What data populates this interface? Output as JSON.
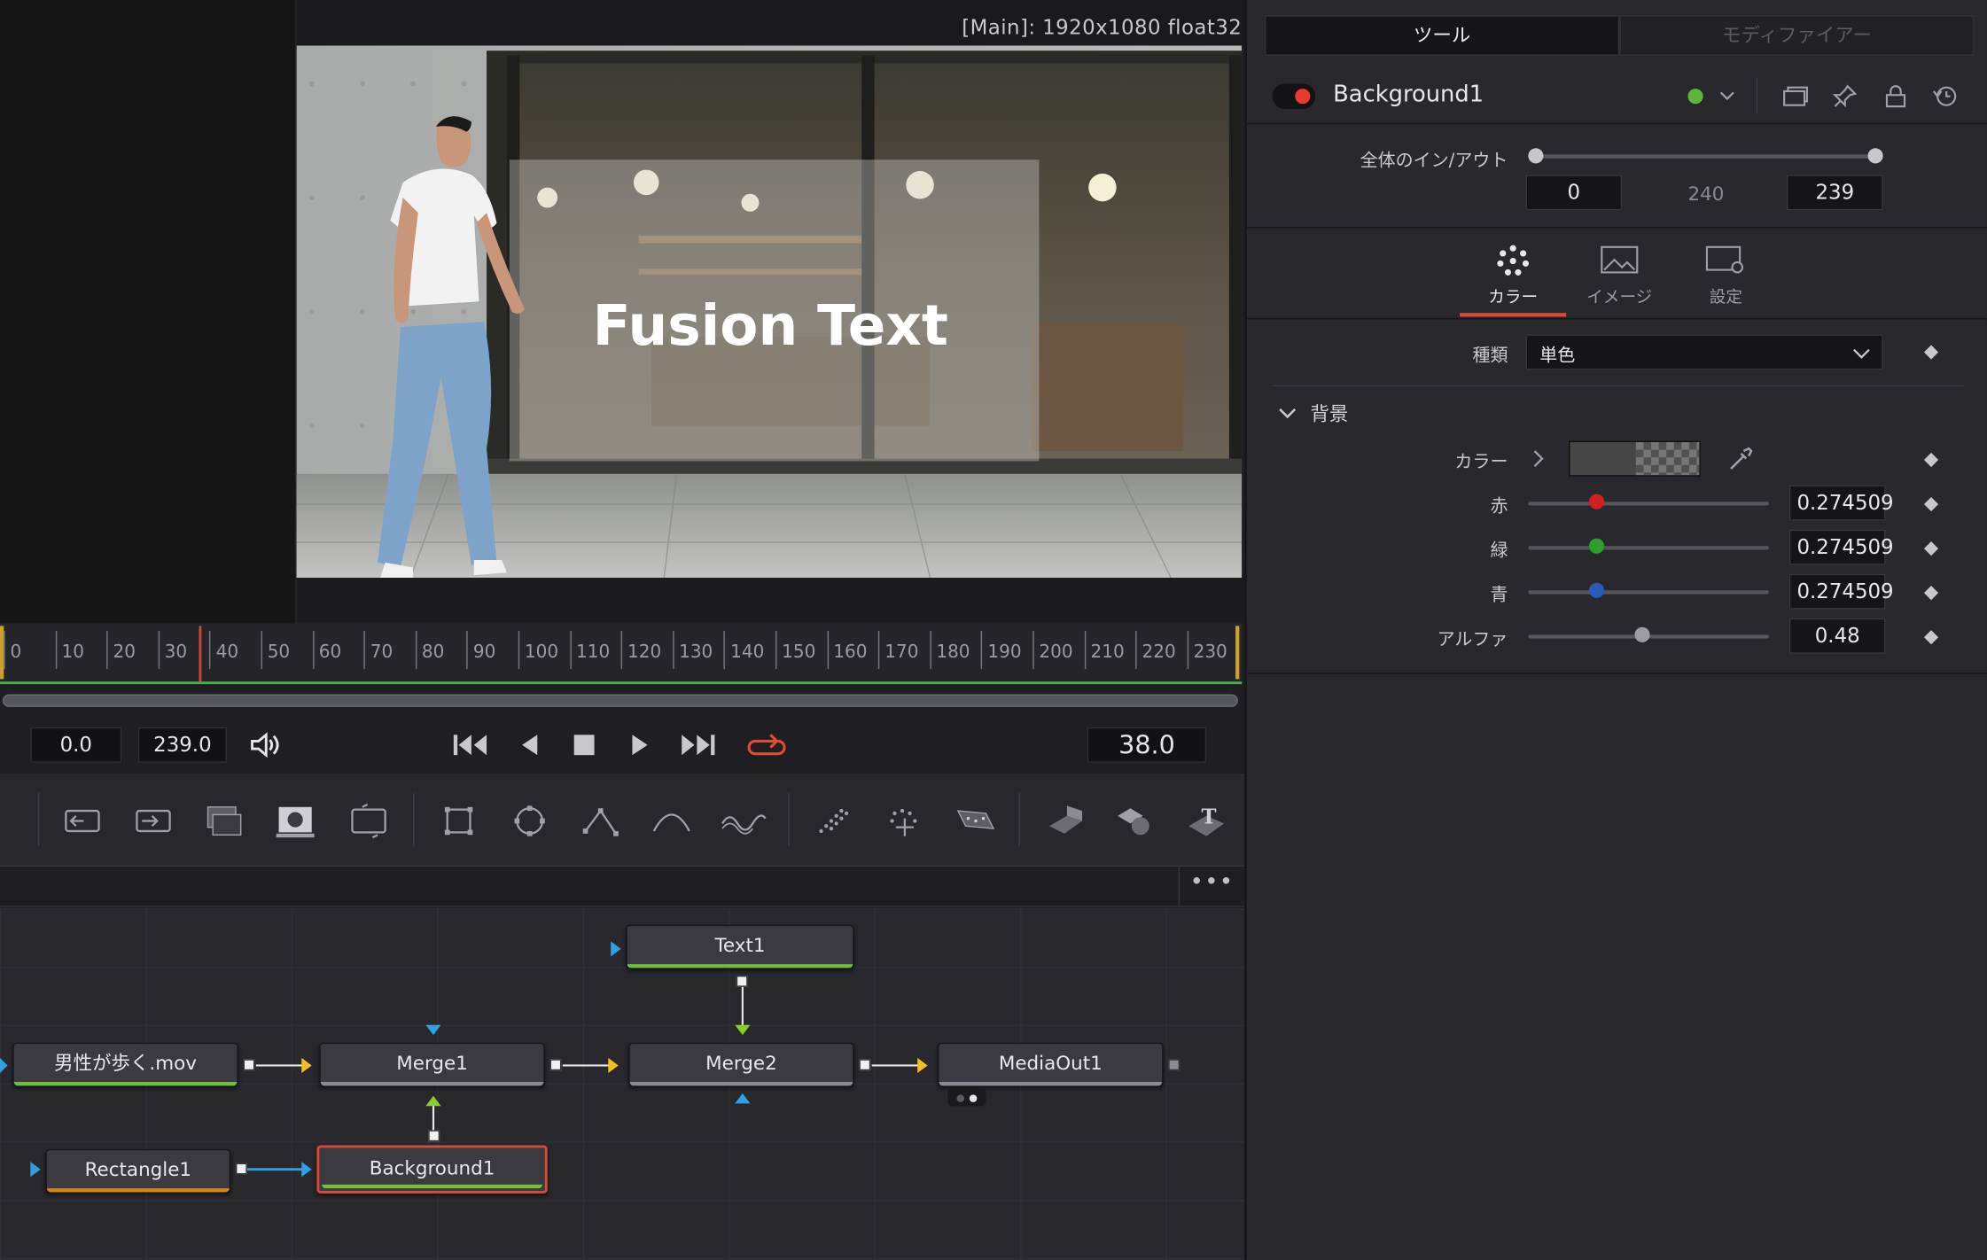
{
  "viewer": {
    "info": "[Main]: 1920x1080 float32",
    "overlay_text": "Fusion Text"
  },
  "timeline": {
    "ticks": [
      "0",
      "10",
      "20",
      "30",
      "40",
      "50",
      "60",
      "70",
      "80",
      "90",
      "100",
      "110",
      "120",
      "130",
      "140",
      "150",
      "160",
      "170",
      "180",
      "190",
      "200",
      "210",
      "220",
      "230"
    ],
    "playhead_frame": 38
  },
  "transport": {
    "start": "0.0",
    "end": "239.0",
    "current": "38.0"
  },
  "toolbar": {
    "icons": [
      "merge-icon",
      "channel-booleans-icon",
      "matte-control-icon",
      "mask-paint-icon",
      "transform-icon",
      "rectangle-mask-icon",
      "ellipse-mask-icon",
      "polygon-mask-icon",
      "bspline-mask-icon",
      "paint-icon",
      "particle-emitter-icon",
      "particle-render-icon",
      "particle-plane-icon",
      "shape3d-icon",
      "merge3d-icon",
      "text3d-icon"
    ]
  },
  "nodes": {
    "text1": "Text1",
    "clip": "男性が歩く.mov",
    "merge1": "Merge1",
    "merge2": "Merge2",
    "mediaout": "MediaOut1",
    "rect": "Rectangle1",
    "bg": "Background1"
  },
  "inspector": {
    "tabs": [
      "ツール",
      "モディファイアー"
    ],
    "tool_name": "Background1",
    "range_label": "全体のイン/アウト",
    "range_in": "0",
    "range_mid": "240",
    "range_out": "239",
    "subtabs": [
      "カラー",
      "イメージ",
      "設定"
    ],
    "type_label": "種類",
    "type_value": "単色",
    "section": "背景",
    "color_label": "カラー",
    "red_label": "赤",
    "green_label": "緑",
    "blue_label": "青",
    "alpha_label": "アルファ",
    "red_value": "0.274509",
    "green_value": "0.274509",
    "blue_value": "0.274509",
    "alpha_value": "0.48"
  },
  "colors": {
    "accent_red": "#d0453a",
    "accent_green": "#4bb04b",
    "node_yellow": "#f0c020",
    "node_blue": "#30a0e0"
  }
}
